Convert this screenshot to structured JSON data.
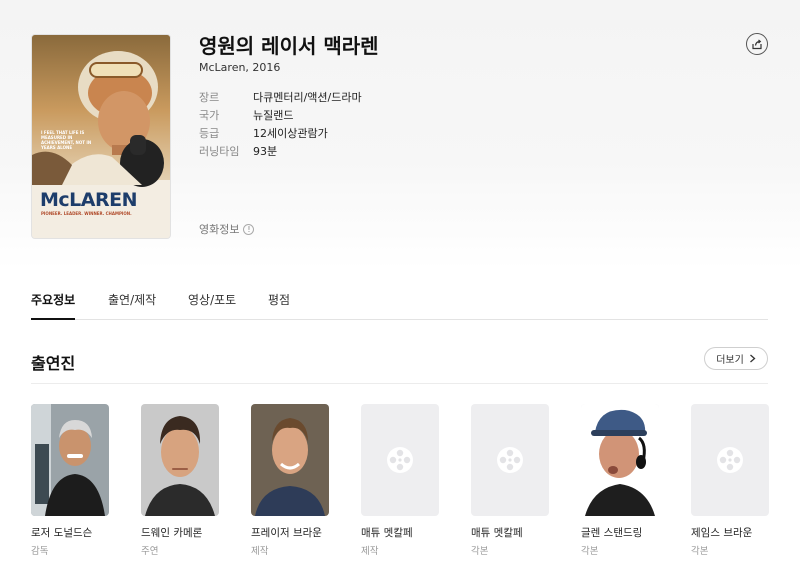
{
  "movie": {
    "title": "영원의 레이서 맥라렌",
    "subtitle": "McLaren, 2016",
    "poster": {
      "tagline": "I FEEL THAT LIFE IS MEASURED IN ACHIEVEMENT, NOT IN YEARS ALONE",
      "title_text": "McLAREN",
      "sub_text": "PIONEER. LEADER. WINNER. CHAMPION."
    },
    "meta": [
      {
        "key": "장르",
        "value": "다큐멘터리/액션/드라마"
      },
      {
        "key": "국가",
        "value": "뉴질랜드"
      },
      {
        "key": "등급",
        "value": "12세이상관람가"
      },
      {
        "key": "러닝타임",
        "value": "93분"
      }
    ],
    "rating_info_label": "영화정보",
    "info_symbol": "!"
  },
  "tabs": [
    {
      "label": "주요정보",
      "active": true
    },
    {
      "label": "출연/제작",
      "active": false
    },
    {
      "label": "영상/포토",
      "active": false
    },
    {
      "label": "평점",
      "active": false
    }
  ],
  "cast_section": {
    "title": "출연진",
    "more_label": "더보기",
    "members": [
      {
        "name": "로저 도널드슨",
        "role": "감독",
        "photo": "gray-haired-man"
      },
      {
        "name": "드웨인 카메론",
        "role": "주연",
        "photo": "dark-haired-man"
      },
      {
        "name": "프레이저 브라운",
        "role": "제작",
        "photo": "smiling-man"
      },
      {
        "name": "매튜 멧칼페",
        "role": "제작",
        "photo": "placeholder-icon"
      },
      {
        "name": "매튜 멧칼페",
        "role": "각본",
        "photo": "placeholder-icon"
      },
      {
        "name": "글렌 스탠드링",
        "role": "각본",
        "photo": "man-with-cap-headphones"
      },
      {
        "name": "제임스 브라운",
        "role": "각본",
        "photo": "placeholder-icon"
      }
    ]
  },
  "colors": {
    "accent": "#111111",
    "muted": "#999999",
    "poster_title": "#1d3d6b"
  }
}
